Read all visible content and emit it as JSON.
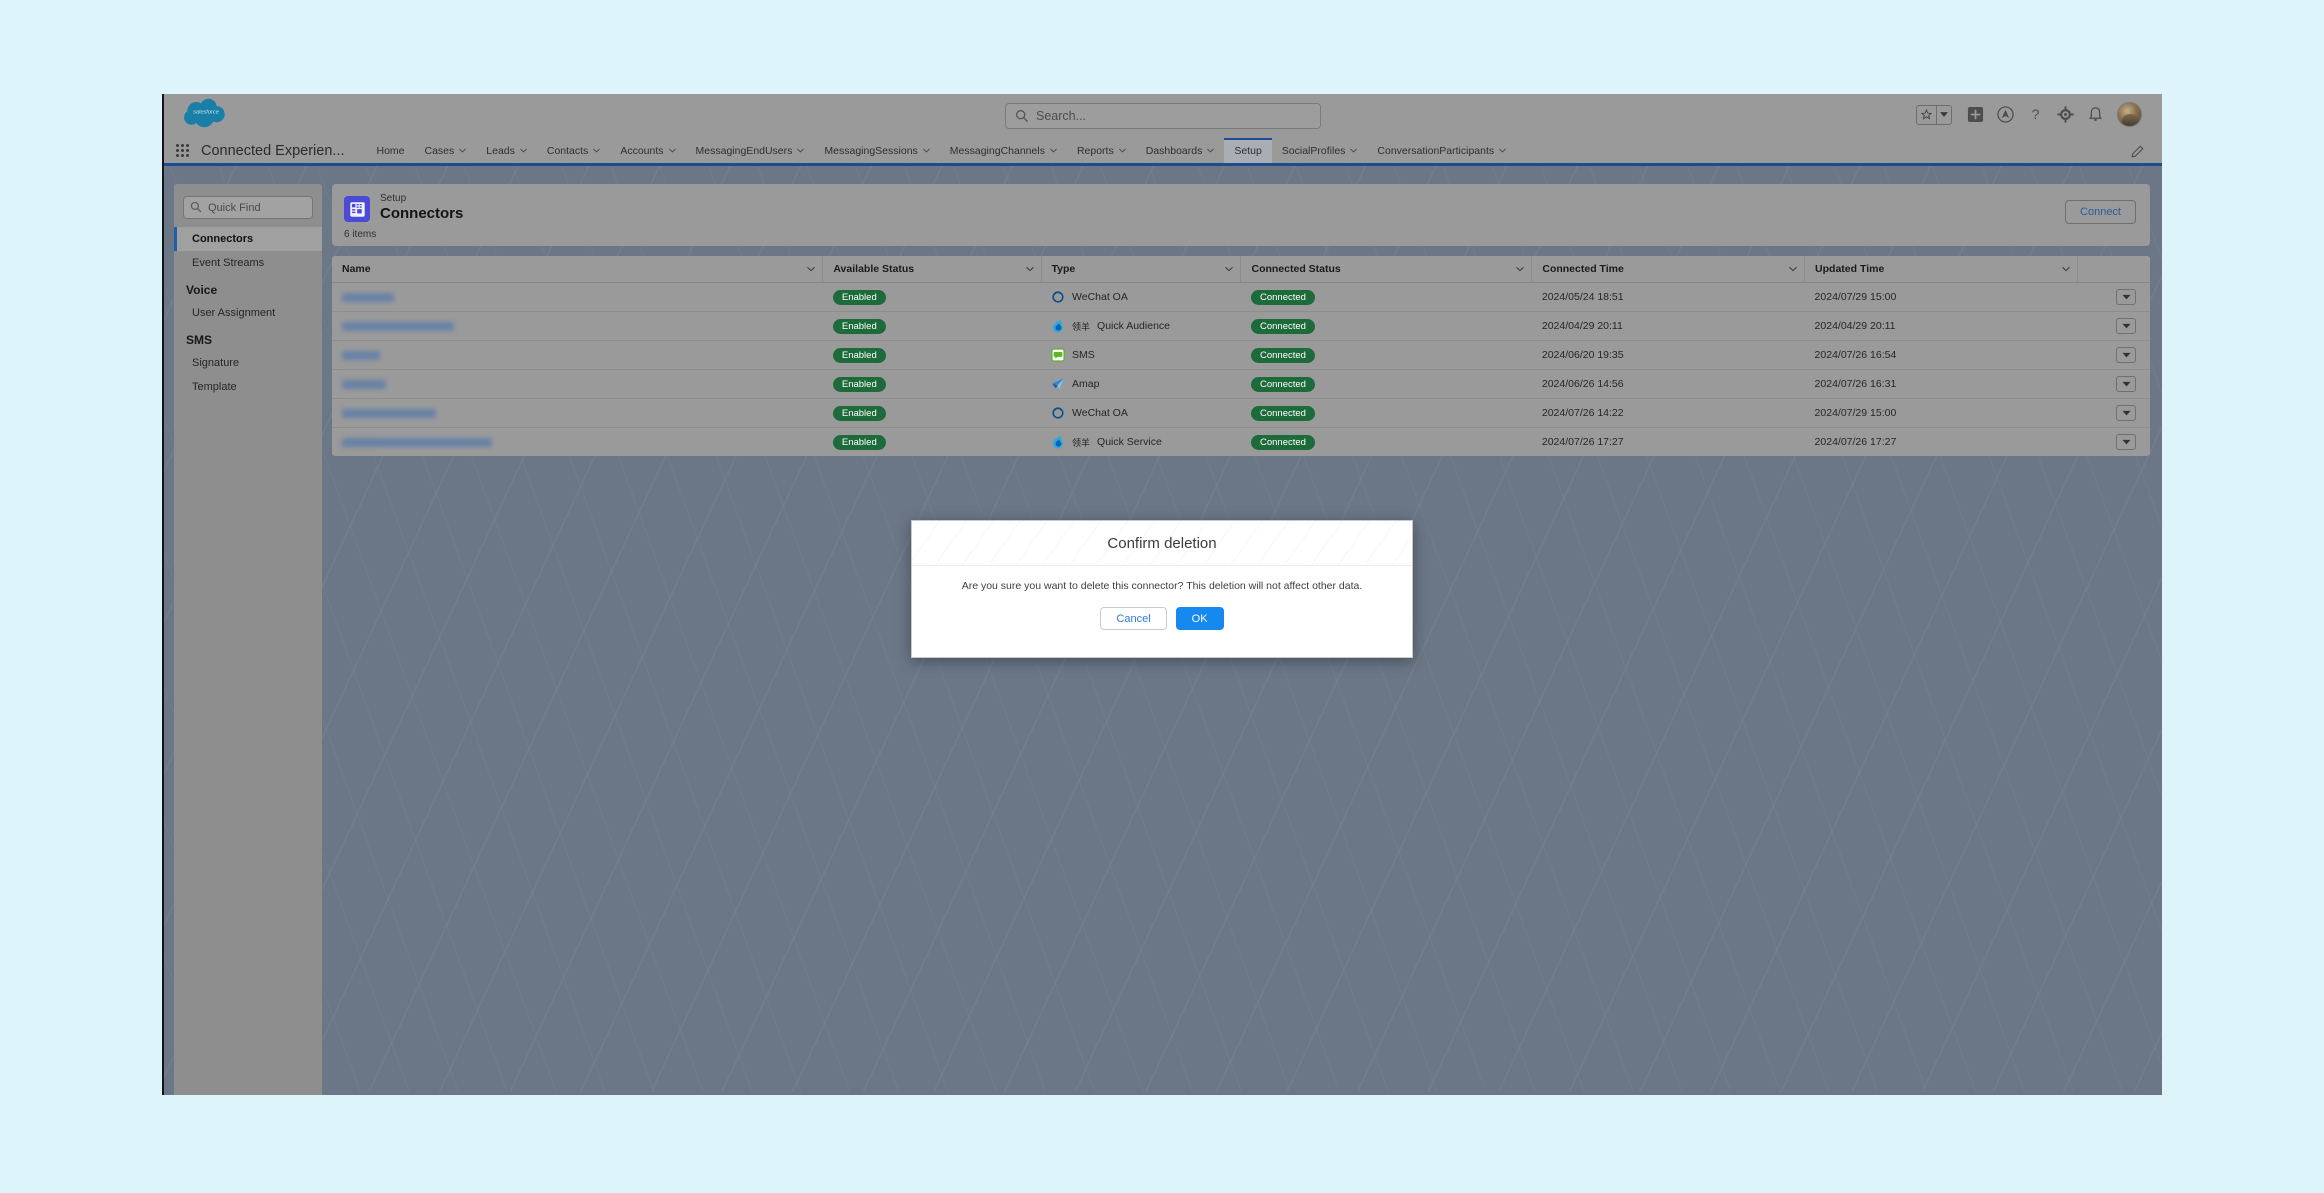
{
  "colors": {
    "backdrop": "#dcf4fa",
    "brand_blue": "#1c4d8f",
    "badge_green": "#1d6b3a",
    "primary_button": "#1589ee",
    "link_blue": "#2a7de1"
  },
  "global_header": {
    "logo_text": "salesforce",
    "search": {
      "placeholder": "Search...",
      "value": ""
    },
    "icons": [
      "favorites-star-icon",
      "favorites-dropdown-icon",
      "add-icon",
      "community-icon",
      "help-icon",
      "setup-gear-icon",
      "notifications-bell-icon",
      "user-avatar"
    ]
  },
  "app_nav": {
    "app_name": "Connected Experien...",
    "items": [
      {
        "label": "Home",
        "has_menu": false,
        "active": false
      },
      {
        "label": "Cases",
        "has_menu": true,
        "active": false
      },
      {
        "label": "Leads",
        "has_menu": true,
        "active": false
      },
      {
        "label": "Contacts",
        "has_menu": true,
        "active": false
      },
      {
        "label": "Accounts",
        "has_menu": true,
        "active": false
      },
      {
        "label": "MessagingEndUsers",
        "has_menu": true,
        "active": false
      },
      {
        "label": "MessagingSessions",
        "has_menu": true,
        "active": false
      },
      {
        "label": "MessagingChannels",
        "has_menu": true,
        "active": false
      },
      {
        "label": "Reports",
        "has_menu": true,
        "active": false
      },
      {
        "label": "Dashboards",
        "has_menu": true,
        "active": false
      },
      {
        "label": "Setup",
        "has_menu": false,
        "active": true
      },
      {
        "label": "SocialProfiles",
        "has_menu": true,
        "active": false
      },
      {
        "label": "ConversationParticipants",
        "has_menu": true,
        "active": false
      }
    ]
  },
  "sidebar": {
    "quick_find": {
      "placeholder": "Quick Find",
      "value": ""
    },
    "items": [
      {
        "label": "Connectors",
        "type": "item",
        "selected": true
      },
      {
        "label": "Event Streams",
        "type": "item",
        "selected": false
      },
      {
        "label": "Voice",
        "type": "heading"
      },
      {
        "label": "User Assignment",
        "type": "item",
        "selected": false
      },
      {
        "label": "SMS",
        "type": "heading"
      },
      {
        "label": "Signature",
        "type": "item",
        "selected": false
      },
      {
        "label": "Template",
        "type": "item",
        "selected": false
      }
    ]
  },
  "page_header": {
    "eyebrow": "Setup",
    "title": "Connectors",
    "item_count": "6 items",
    "connect_label": "Connect",
    "icon": "connectors-grid-icon"
  },
  "table": {
    "columns": [
      {
        "label": "Name",
        "has_menu": true
      },
      {
        "label": "Available Status",
        "has_menu": true
      },
      {
        "label": "Type",
        "has_menu": true
      },
      {
        "label": "Connected Status",
        "has_menu": true
      },
      {
        "label": "Connected Time",
        "has_menu": true
      },
      {
        "label": "Updated Time",
        "has_menu": true
      }
    ],
    "rows": [
      {
        "name": "",
        "name_redacted": true,
        "name_width": 52,
        "available_status": "Enabled",
        "type": "WeChat OA",
        "type_icon": "wechat-oa-icon",
        "type_prefix": "",
        "connected_status": "Connected",
        "connected_time": "2024/05/24 18:51",
        "updated_time": "2024/07/29 15:00"
      },
      {
        "name": "",
        "name_redacted": true,
        "name_width": 112,
        "available_status": "Enabled",
        "type": "Quick Audience",
        "type_icon": "lingyang-icon",
        "type_prefix": "领羊",
        "connected_status": "Connected",
        "connected_time": "2024/04/29 20:11",
        "updated_time": "2024/04/29 20:11"
      },
      {
        "name": "",
        "name_redacted": true,
        "name_width": 38,
        "available_status": "Enabled",
        "type": "SMS",
        "type_icon": "sms-icon",
        "type_prefix": "",
        "connected_status": "Connected",
        "connected_time": "2024/06/20 19:35",
        "updated_time": "2024/07/26 16:54"
      },
      {
        "name": "",
        "name_redacted": true,
        "name_width": 44,
        "available_status": "Enabled",
        "type": "Amap",
        "type_icon": "amap-icon",
        "type_prefix": "",
        "connected_status": "Connected",
        "connected_time": "2024/06/26 14:56",
        "updated_time": "2024/07/26 16:31"
      },
      {
        "name": "",
        "name_redacted": true,
        "name_width": 94,
        "available_status": "Enabled",
        "type": "WeChat OA",
        "type_icon": "wechat-oa-icon",
        "type_prefix": "",
        "connected_status": "Connected",
        "connected_time": "2024/07/26 14:22",
        "updated_time": "2024/07/29 15:00"
      },
      {
        "name": "",
        "name_redacted": true,
        "name_width": 150,
        "available_status": "Enabled",
        "type": "Quick Service",
        "type_icon": "lingyang-icon",
        "type_prefix": "领羊",
        "connected_status": "Connected",
        "connected_time": "2024/07/26 17:27",
        "updated_time": "2024/07/26 17:27"
      }
    ],
    "row_action_icon": "row-actions-chevron-icon"
  },
  "modal": {
    "title": "Confirm deletion",
    "message": "Are you sure you want to delete this connector? This deletion will not affect other data.",
    "cancel_label": "Cancel",
    "ok_label": "OK"
  }
}
